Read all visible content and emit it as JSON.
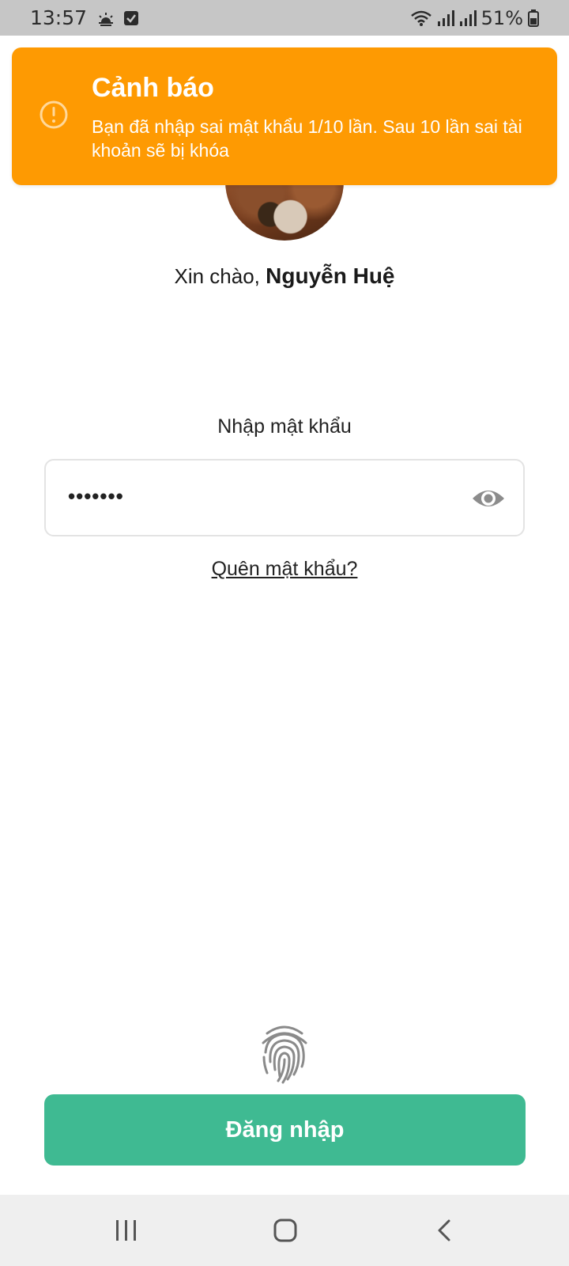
{
  "status_bar": {
    "time": "13:57",
    "battery": "51%",
    "icons": [
      "weather-icon",
      "checkbox-notification-icon",
      "wifi-icon",
      "signal-icon",
      "signal-icon",
      "battery-icon"
    ]
  },
  "toast": {
    "title": "Cảnh báo",
    "message": "Bạn đã nhập sai mật khẩu 1/10 lần. Sau 10 lần sai tài khoản sẽ bị khóa",
    "icon": "warning-icon",
    "color": "#fe9a02"
  },
  "greeting": {
    "prefix": "Xin chào, ",
    "name": "Nguyễn Huệ"
  },
  "password": {
    "label": "Nhập mật khẩu",
    "value": "•••••••"
  },
  "forgot_link": "Quên mật khẩu?",
  "login_button": {
    "label": "Đăng nhập",
    "color": "#3fba92"
  },
  "nav_bar": {
    "icons": [
      "recents-icon",
      "home-icon",
      "back-icon"
    ]
  }
}
